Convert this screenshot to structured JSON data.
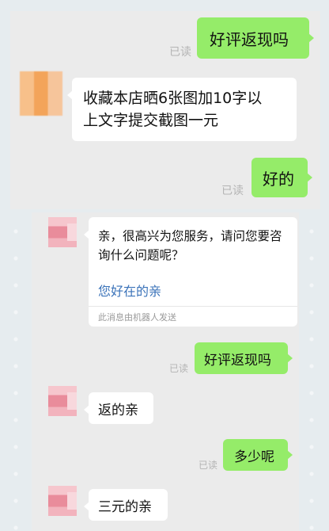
{
  "read_label": "已读",
  "screen1": {
    "messages": [
      {
        "side": "right",
        "text": "好评返现吗"
      },
      {
        "side": "left",
        "text_line1": "收藏本店晒6张图加10字以",
        "text_line2": "上文字提交截图一元"
      },
      {
        "side": "right",
        "text": "好的"
      }
    ]
  },
  "screen2": {
    "bot": {
      "text": "亲，很高兴为您服务，请问您要咨询什么问题呢？",
      "link": "您好在的亲",
      "note": "此消息由机器人发送"
    },
    "messages": [
      {
        "side": "right",
        "text": "好评返现吗"
      },
      {
        "side": "left",
        "text": "返的亲"
      },
      {
        "side": "right",
        "text": "多少呢"
      },
      {
        "side": "left",
        "text": "三元的亲"
      }
    ]
  }
}
